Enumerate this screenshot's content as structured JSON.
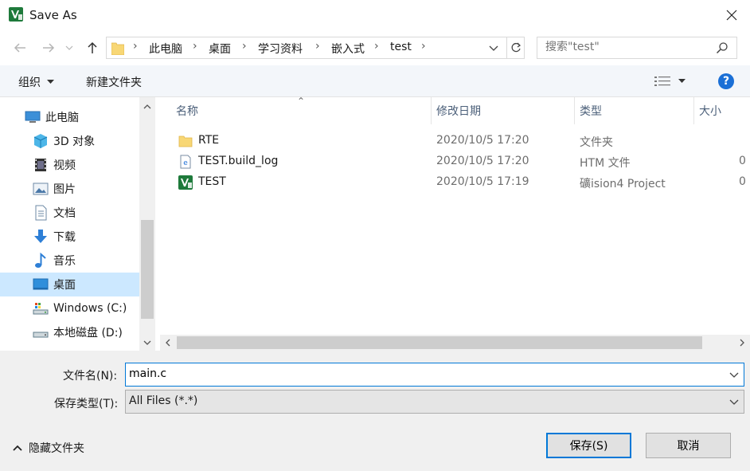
{
  "window": {
    "title": "Save As"
  },
  "address": {
    "crumbs": [
      "此电脑",
      "桌面",
      "学习资料",
      "嵌入式",
      "test"
    ]
  },
  "search": {
    "placeholder": "搜索\"test\""
  },
  "toolbar": {
    "organize": "组织",
    "new_folder": "新建文件夹"
  },
  "sidebar": {
    "items": [
      {
        "label": "此电脑",
        "icon": "computer-icon"
      },
      {
        "label": "3D 对象",
        "icon": "cube-icon"
      },
      {
        "label": "视频",
        "icon": "video-icon"
      },
      {
        "label": "图片",
        "icon": "pictures-icon"
      },
      {
        "label": "文档",
        "icon": "document-icon"
      },
      {
        "label": "下载",
        "icon": "download-icon"
      },
      {
        "label": "音乐",
        "icon": "music-icon"
      },
      {
        "label": "桌面",
        "icon": "desktop-icon",
        "selected": true
      },
      {
        "label": "Windows (C:)",
        "icon": "drive-icon"
      },
      {
        "label": "本地磁盘 (D:)",
        "icon": "drive-icon"
      }
    ]
  },
  "columns": {
    "name": "名称",
    "date": "修改日期",
    "type": "类型",
    "size": "大小"
  },
  "files": [
    {
      "name": "RTE",
      "date": "2020/10/5 17:20",
      "type": "文件夹",
      "size": "",
      "icon": "folder-icon"
    },
    {
      "name": "TEST.build_log",
      "date": "2020/10/5 17:20",
      "type": "HTM 文件",
      "size": "0",
      "icon": "html-file-icon"
    },
    {
      "name": "TEST",
      "date": "2020/10/5 17:19",
      "type": "礦ision4 Project",
      "size": "0",
      "icon": "uvision-icon"
    }
  ],
  "form": {
    "filename_label": "文件名(N):",
    "filename_value": "main.c",
    "filetype_label": "保存类型(T):",
    "filetype_value": "All Files (*.*)"
  },
  "footer": {
    "hide_folders": "隐藏文件夹",
    "save": "保存(S)",
    "cancel": "取消"
  },
  "colors": {
    "accent": "#0078d7",
    "selected": "#cce8ff",
    "toolbar_bg": "#f3f6fa"
  }
}
